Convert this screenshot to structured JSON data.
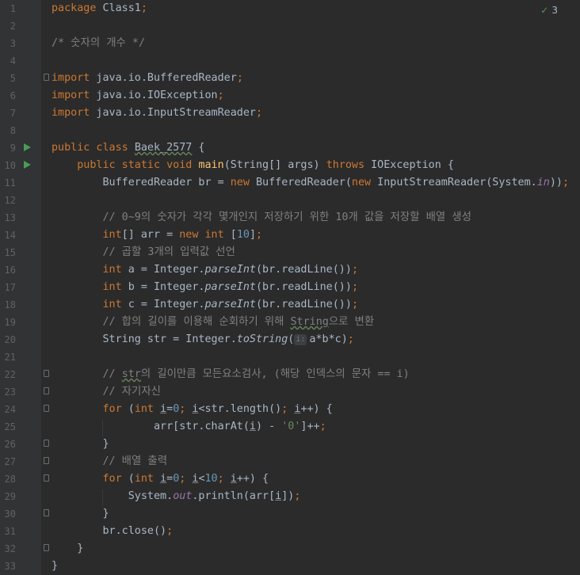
{
  "inspection": {
    "icon": "check-icon",
    "count": "3",
    "color": "#499c54"
  },
  "lines": [
    {
      "n": "1",
      "html": "<span class=\"kw\">package</span> Class1<span class=\"kw\">;</span>"
    },
    {
      "n": "2",
      "html": ""
    },
    {
      "n": "3",
      "html": "<span class=\"com\">/* 숫자의 개수 */</span>"
    },
    {
      "n": "4",
      "html": ""
    },
    {
      "n": "5",
      "html": "<span class=\"kw\">import</span> java.io.BufferedReader<span class=\"kw\">;</span>"
    },
    {
      "n": "6",
      "html": "<span class=\"kw\">import</span> java.io.IOException<span class=\"kw\">;</span>"
    },
    {
      "n": "7",
      "html": "<span class=\"kw\">import</span> java.io.InputStreamReader<span class=\"kw\">;</span>"
    },
    {
      "n": "8",
      "html": ""
    },
    {
      "n": "9",
      "html": "<span class=\"kw\">public class</span> <span class=\"wav\">Baek_2577</span> {"
    },
    {
      "n": "10",
      "html": "    <span class=\"kw\">public static void</span> <span class=\"fn\">main</span>(String[] args) <span class=\"kw\">throws</span> IOException {"
    },
    {
      "n": "11",
      "html": "        BufferedReader br = <span class=\"kw\">new</span> BufferedReader(<span class=\"kw\">new</span> InputStreamReader(System.<span class=\"stat\">in</span>))<span class=\"kw\">;</span>"
    },
    {
      "n": "12",
      "html": ""
    },
    {
      "n": "13",
      "html": "        <span class=\"com\">// 0~9의 숫자가 각각 몇개인지 저장하기 위한 10개 값을 저장할 배열 생성</span>"
    },
    {
      "n": "14",
      "html": "        <span class=\"kw\">int</span>[] arr = <span class=\"kw\">new int</span> [<span class=\"num\">10</span>]<span class=\"kw\">;</span>"
    },
    {
      "n": "15",
      "html": "        <span class=\"com\">// 곱할 3개의 입력값 선언</span>"
    },
    {
      "n": "16",
      "html": "        <span class=\"kw\">int</span> a = Integer.<span class=\"it\">parseInt</span>(br.readLine())<span class=\"kw\">;</span>"
    },
    {
      "n": "17",
      "html": "        <span class=\"kw\">int</span> b = Integer.<span class=\"it\">parseInt</span>(br.readLine())<span class=\"kw\">;</span>"
    },
    {
      "n": "18",
      "html": "        <span class=\"kw\">int</span> c = Integer.<span class=\"it\">parseInt</span>(br.readLine())<span class=\"kw\">;</span>"
    },
    {
      "n": "19",
      "html": "        <span class=\"com\">// 합의 길이를 이용해 순회하기 위해 <span class=\"wav\">String</span>으로 변환</span>"
    },
    {
      "n": "20",
      "html": "        String str = Integer.<span class=\"it\">toString</span>(<span class=\"hint\">i:</span>a*b*c)<span class=\"kw\">;</span>"
    },
    {
      "n": "21",
      "html": ""
    },
    {
      "n": "22",
      "html": "        <span class=\"com\">// <span class=\"wav\">str</span>의 길이만큼 모든요소검사, (해당 인덱스의 문자 == i)</span>"
    },
    {
      "n": "23",
      "html": "        <span class=\"com\">// 자기자신</span>"
    },
    {
      "n": "24",
      "html": "        <span class=\"kw\">for</span> (<span class=\"kw\">int</span> <span class=\"ul\">i</span>=<span class=\"num\">0</span><span class=\"kw\">;</span> <span class=\"ul\">i</span>&lt;str.length()<span class=\"kw\">;</span> <span class=\"ul\">i</span>++) {"
    },
    {
      "n": "25",
      "html": "                arr[str.charAt(<span class=\"ul\">i</span>) - <span class=\"str\">'0'</span>]++<span class=\"kw\">;</span>"
    },
    {
      "n": "26",
      "html": "        }"
    },
    {
      "n": "27",
      "html": "        <span class=\"com\">// 배열 출력</span>"
    },
    {
      "n": "28",
      "html": "        <span class=\"kw\">for</span> (<span class=\"kw\">int</span> <span class=\"ul\">i</span>=<span class=\"num\">0</span><span class=\"kw\">;</span> <span class=\"ul\">i</span>&lt;<span class=\"num\">10</span><span class=\"kw\">;</span> <span class=\"ul\">i</span>++) {"
    },
    {
      "n": "29",
      "html": "            System.<span class=\"stat\">out</span>.println(arr[<span class=\"ul\">i</span>])<span class=\"kw\">;</span>"
    },
    {
      "n": "30",
      "html": "        }"
    },
    {
      "n": "31",
      "html": "        br.close()<span class=\"kw\">;</span>"
    },
    {
      "n": "32",
      "html": "    }"
    },
    {
      "n": "33",
      "html": "}"
    }
  ],
  "folds": [
    "5",
    "22",
    "23",
    "24",
    "26",
    "27",
    "28",
    "30",
    "32"
  ],
  "runs": [
    "9",
    "10"
  ]
}
